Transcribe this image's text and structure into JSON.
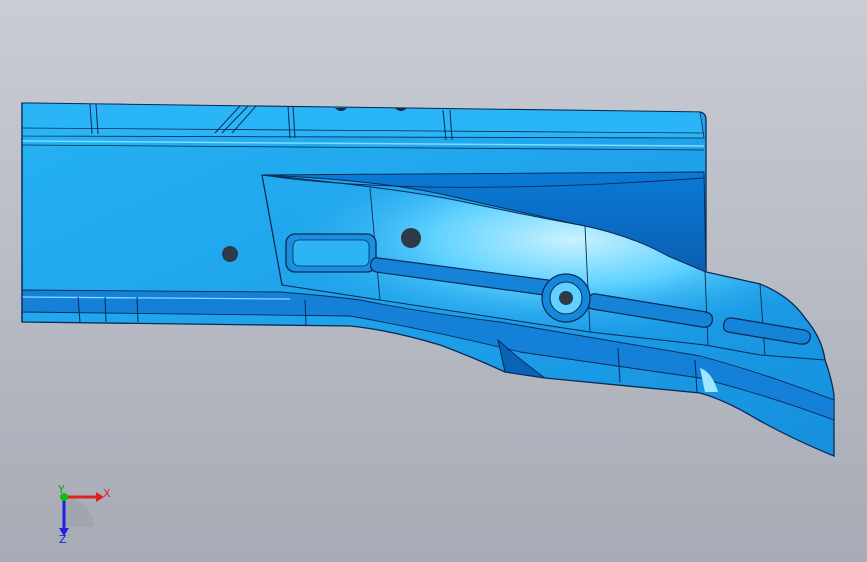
{
  "viewport": {
    "background_top": "#c9ccd4",
    "background_bottom": "#a7abb5",
    "part_color": "#1ea2ea",
    "part_light": "#7ad8ff",
    "part_dark": "#0b63b8",
    "edge_color": "#0a2a55",
    "hole_color": "#2f3a47"
  },
  "triad": {
    "x_label": "X",
    "y_label": "Y",
    "z_label": "Z",
    "x_color": "#e02020",
    "y_color": "#10c010",
    "z_color": "#2020e0"
  }
}
